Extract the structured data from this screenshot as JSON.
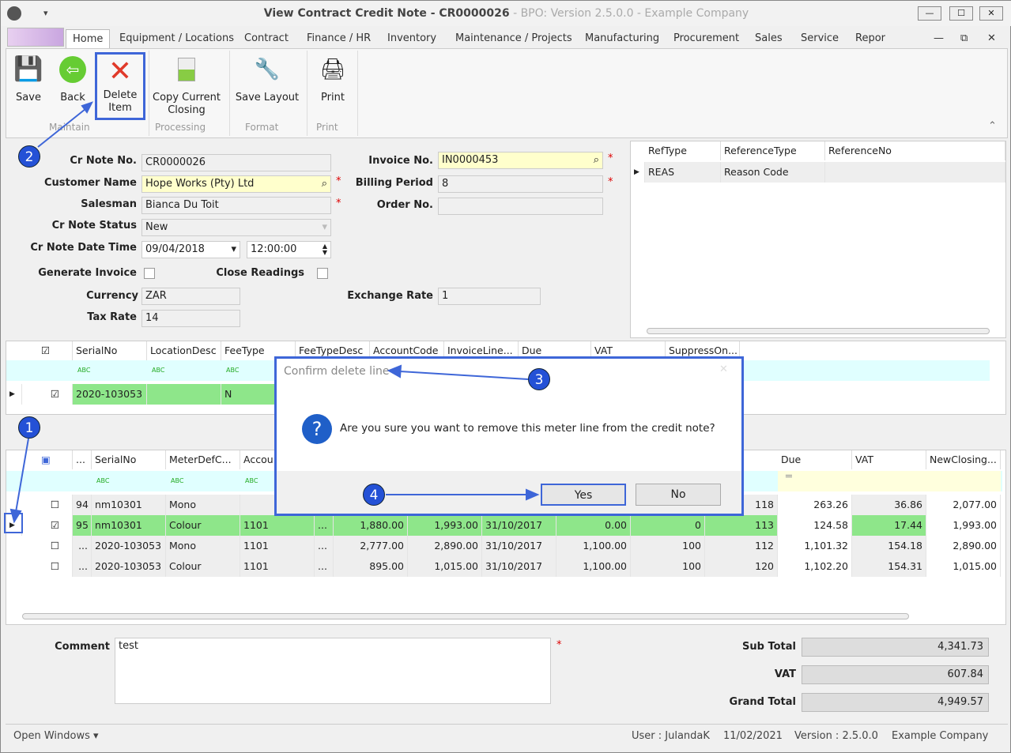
{
  "window": {
    "title": "View Contract Credit Note  - CR0000026",
    "subtitle": " - BPO: Version 2.5.0.0 - Example Company",
    "min": "—",
    "max": "☐",
    "close": "✕"
  },
  "menu_tabs": [
    "Home",
    "Equipment / Locations",
    "Contract",
    "Finance / HR",
    "Inventory",
    "Maintenance / Projects",
    "Manufacturing",
    "Procurement",
    "Sales",
    "Service",
    "Repor"
  ],
  "ribbon": {
    "buttons": [
      {
        "label": "Save"
      },
      {
        "label": "Back"
      },
      {
        "label": "Delete Item"
      },
      {
        "label": "Copy Current Closing"
      },
      {
        "label": "Save Layout"
      },
      {
        "label": "Print"
      }
    ],
    "groups": [
      "Maintain",
      "Processing",
      "Format",
      "Print"
    ]
  },
  "form": {
    "cr_note_no": {
      "label": "Cr Note No.",
      "value": "CR0000026"
    },
    "customer_name": {
      "label": "Customer Name",
      "value": "Hope Works (Pty) Ltd"
    },
    "salesman": {
      "label": "Salesman",
      "value": "Bianca Du Toit"
    },
    "status": {
      "label": "Cr Note Status",
      "value": "New"
    },
    "date_time": {
      "label": "Cr Note Date Time",
      "date": "09/04/2018",
      "time": "12:00:00"
    },
    "generate_invoice": {
      "label": "Generate Invoice",
      "checked": false
    },
    "close_readings": {
      "label": "Close Readings",
      "checked": false
    },
    "currency": {
      "label": "Currency",
      "value": "ZAR"
    },
    "tax_rate": {
      "label": "Tax Rate",
      "value": "14"
    },
    "invoice_no": {
      "label": "Invoice No.",
      "value": "IN0000453"
    },
    "billing_period": {
      "label": "Billing Period",
      "value": "8"
    },
    "order_no": {
      "label": "Order No.",
      "value": ""
    },
    "exchange_rate": {
      "label": "Exchange Rate",
      "value": "1"
    },
    "required": "*"
  },
  "ref_grid": {
    "headers": [
      "RefType",
      "ReferenceType",
      "ReferenceNo"
    ],
    "rows": [
      [
        "REAS",
        "Reason Code",
        ""
      ]
    ]
  },
  "equip_grid": {
    "headers": [
      "SerialNo",
      "LocationDesc",
      "FeeType",
      "FeeTypeDesc",
      "AccountCode",
      "InvoiceLine...",
      "Due",
      "VAT",
      "SuppressOn..."
    ],
    "rows": [
      [
        "2020-103053",
        "",
        "N"
      ]
    ]
  },
  "meter_grid": {
    "headers": [
      "...",
      "SerialNo",
      "MeterDefC...",
      "Accou",
      "Due",
      "VAT",
      "NewClosing..."
    ],
    "rows": [
      {
        "checked": false,
        "no": "94",
        "serial": "nm10301",
        "meter": "Mono",
        "acc": "",
        "c1": "",
        "c2": "",
        "date": "",
        "c3": "",
        "c4": "",
        "c5": "118",
        "due": "263.26",
        "vat": "36.86",
        "closing": "2,077.00"
      },
      {
        "checked": true,
        "no": "95",
        "serial": "nm10301",
        "meter": "Colour",
        "acc": "1101",
        "c1": "1,880.00",
        "c2": "1,993.00",
        "date": "31/10/2017",
        "c3": "0.00",
        "c4": "0",
        "c5": "113",
        "due": "124.58",
        "vat": "17.44",
        "closing": "1,993.00"
      },
      {
        "checked": false,
        "no": "...",
        "serial": "2020-103053",
        "meter": "Mono",
        "acc": "1101",
        "c1": "2,777.00",
        "c2": "2,890.00",
        "date": "31/10/2017",
        "c3": "1,100.00",
        "c4": "100",
        "c5": "112",
        "due": "1,101.32",
        "vat": "154.18",
        "closing": "2,890.00"
      },
      {
        "checked": false,
        "no": "...",
        "serial": "2020-103053",
        "meter": "Colour",
        "acc": "1101",
        "c1": "895.00",
        "c2": "1,015.00",
        "date": "31/10/2017",
        "c3": "1,100.00",
        "c4": "100",
        "c5": "120",
        "due": "1,102.20",
        "vat": "154.31",
        "closing": "1,015.00"
      }
    ]
  },
  "comment": {
    "label": "Comment",
    "value": "test"
  },
  "totals": {
    "sub_total_label": "Sub Total",
    "sub_total": "4,341.73",
    "vat_label": "VAT",
    "vat": "607.84",
    "grand_total_label": "Grand Total",
    "grand_total": "4,949.57"
  },
  "dialog": {
    "title": "Confirm delete line",
    "message": "Are you sure you want to remove this meter line from the credit note?",
    "yes": "Yes",
    "no": "No"
  },
  "callouts": [
    "1",
    "2",
    "3",
    "4"
  ],
  "status": {
    "open_windows": "Open Windows ▾",
    "user": "User : JulandaK",
    "date": "11/02/2021",
    "version": "Version : 2.5.0.0",
    "company": "Example Company"
  },
  "colors": {
    "accent": "#3e66d8",
    "selected_row": "#8ee68a",
    "required_field": "#ffffcc"
  }
}
